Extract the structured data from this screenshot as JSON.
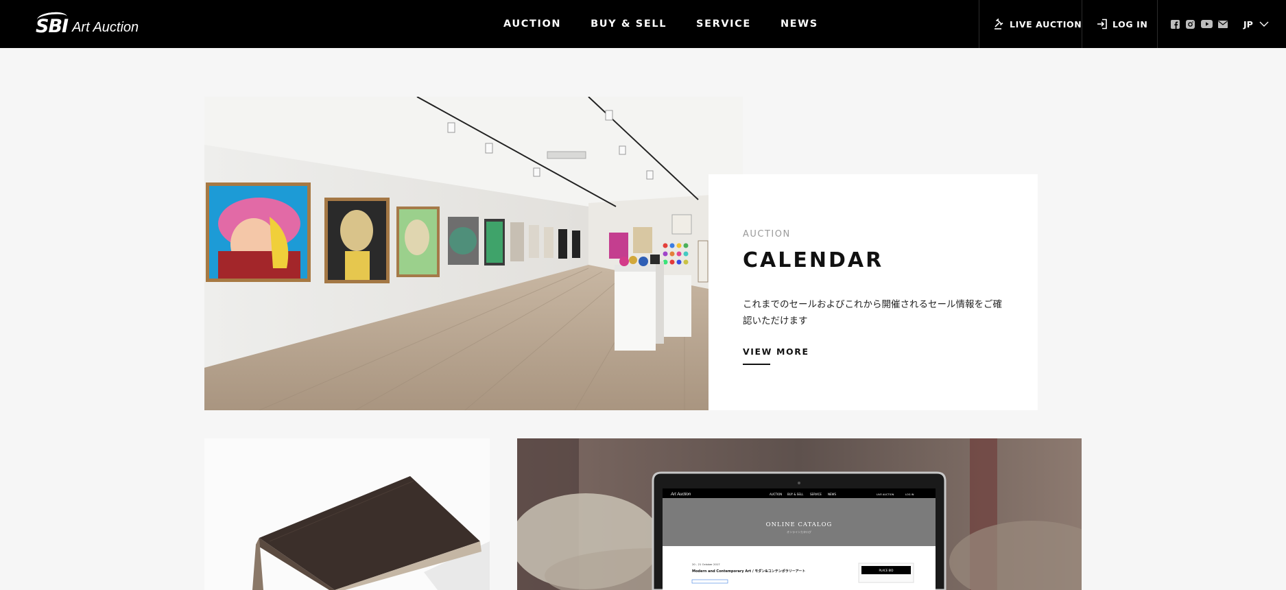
{
  "header": {
    "logo": {
      "mark": "SBI",
      "text": "Art Auction"
    },
    "nav": [
      "AUCTION",
      "BUY & SELL",
      "SERVICE",
      "NEWS"
    ],
    "live_auction_label": "LIVE AUCTION",
    "login_label": "LOG IN",
    "language": "JP",
    "social_icons": [
      "facebook-icon",
      "instagram-icon",
      "youtube-icon",
      "mail-icon"
    ]
  },
  "feature": {
    "kicker": "AUCTION",
    "title": "CALENDAR",
    "description": "これまでのセールおよびこれから開催されるセール情報をご確認いただけます",
    "link_label": "VIEW MORE"
  },
  "laptop_screen": {
    "logo_text": "Art Auction",
    "nav": [
      "AUCTION",
      "BUY & SELL",
      "SERVICE",
      "NEWS"
    ],
    "live_label": "LIVE AUCTION",
    "login_label": "LOG IN",
    "catalog_title": "ONLINE CATALOG",
    "catalog_subtitle": "オンラインカタログ",
    "sale_date": "20 - 21 October 2017",
    "sale_title": "Modern and Contemporary Art / モダン&コンテンポラリーアート",
    "place_bid_label": "PLACE BID"
  },
  "colors": {
    "header_bg": "#000000",
    "page_bg": "#f6f6f6",
    "card_bg": "#ffffff",
    "kicker": "#9a9a9a"
  }
}
